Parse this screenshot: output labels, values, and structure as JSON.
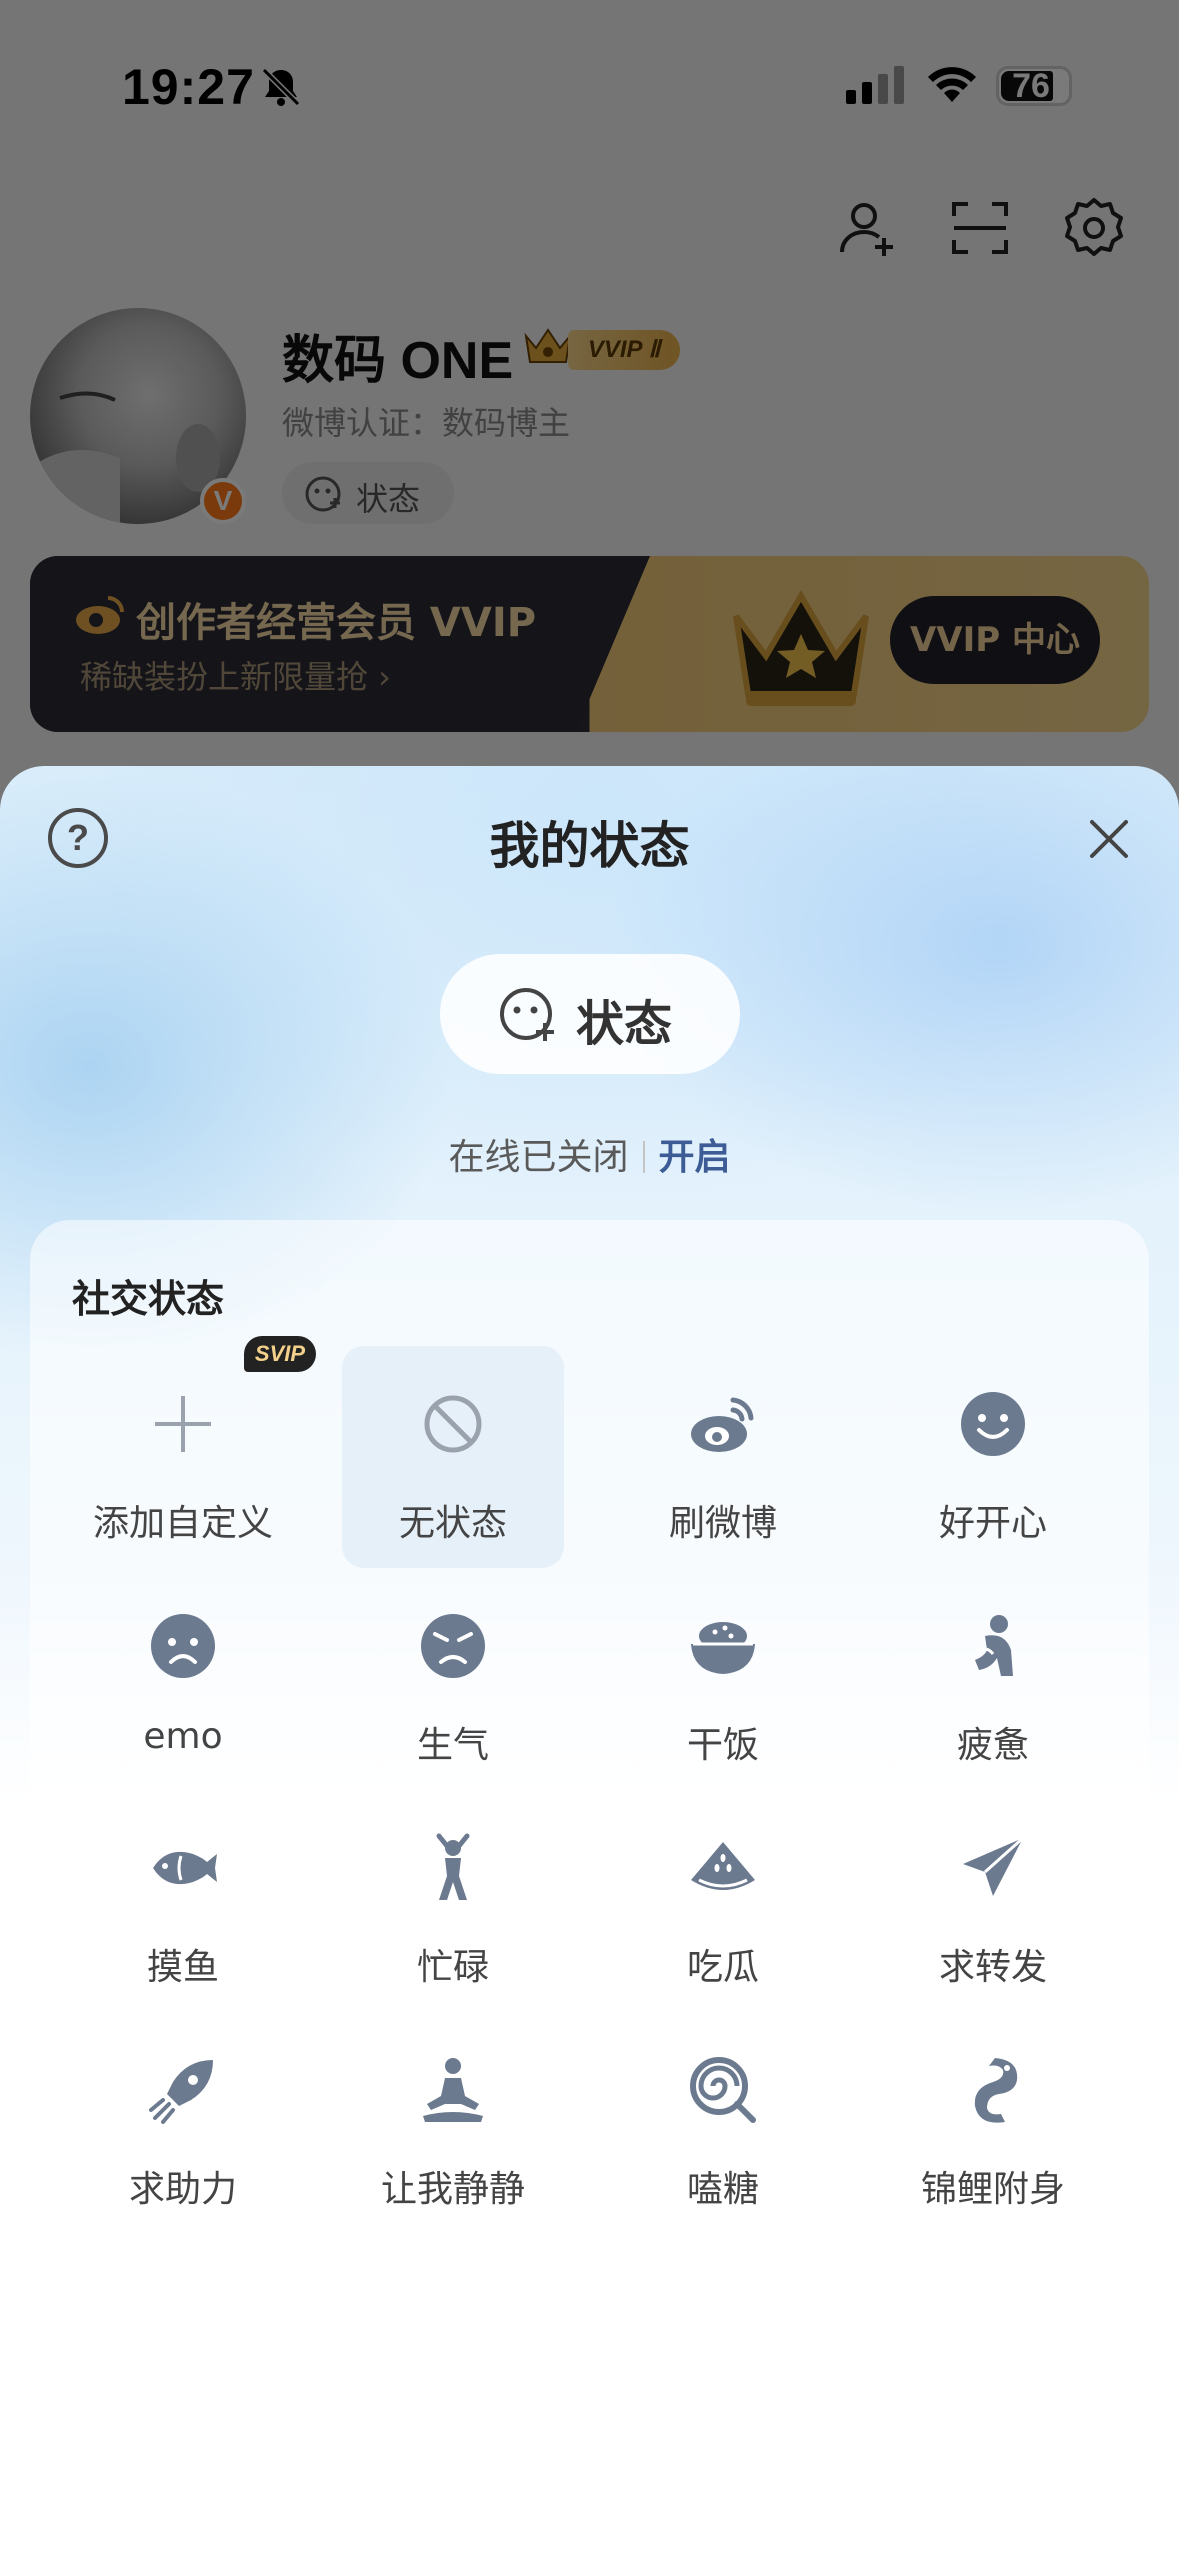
{
  "status_bar": {
    "time": "19:27",
    "battery": "76"
  },
  "profile": {
    "name": "数码 ONE",
    "vip_tag": "VVIP Ⅱ",
    "verification": "微博认证：数码博主",
    "status_chip": "状态"
  },
  "banner": {
    "title": "创作者经营会员 VVIP",
    "subtitle": "稀缺装扮上新限量抢 ›",
    "button": "VVIP 中心"
  },
  "sheet": {
    "help": "?",
    "title": "我的状态",
    "status_button": "状态",
    "online_status": "在线已关闭",
    "online_action": "开启",
    "section_title": "社交状态",
    "svip_badge": "SVIP",
    "items": [
      {
        "label": "添加自定义",
        "icon": "plus-icon"
      },
      {
        "label": "无状态",
        "icon": "no-status-icon",
        "selected": true
      },
      {
        "label": "刷微博",
        "icon": "weibo-icon"
      },
      {
        "label": "好开心",
        "icon": "happy-face-icon"
      },
      {
        "label": "emo",
        "icon": "sad-face-icon"
      },
      {
        "label": "生气",
        "icon": "angry-face-icon"
      },
      {
        "label": "干饭",
        "icon": "rice-bowl-icon"
      },
      {
        "label": "疲惫",
        "icon": "tired-person-icon"
      },
      {
        "label": "摸鱼",
        "icon": "fish-icon"
      },
      {
        "label": "忙碌",
        "icon": "busy-person-icon"
      },
      {
        "label": "吃瓜",
        "icon": "watermelon-icon"
      },
      {
        "label": "求转发",
        "icon": "paper-plane-icon"
      },
      {
        "label": "求助力",
        "icon": "rocket-icon"
      },
      {
        "label": "让我静静",
        "icon": "meditation-icon"
      },
      {
        "label": "嗑糖",
        "icon": "lollipop-icon"
      },
      {
        "label": "锦鲤附身",
        "icon": "koi-icon"
      }
    ]
  },
  "colors": {
    "icon": "#6c7a90",
    "accent": "#3d5c96",
    "vip_gold": "#f2d39b"
  }
}
